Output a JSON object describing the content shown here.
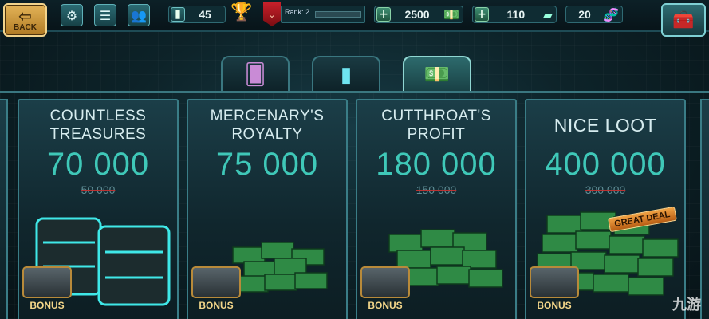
{
  "topbar": {
    "back_label": "BACK",
    "level_value": "45",
    "rank_label": "Rank: 2",
    "rank_progress": 0.0,
    "currency_value": "2500",
    "gems_value": "110",
    "dna_value": "20"
  },
  "tabs": [
    {
      "name": "cards"
    },
    {
      "name": "energy"
    },
    {
      "name": "money"
    }
  ],
  "active_tab": 2,
  "cards": [
    {
      "title_line1": "COUNTLESS",
      "title_line2": "TREASURES",
      "amount": "70 000",
      "old_amount": "50 000",
      "bonus_label": "BONUS"
    },
    {
      "title_line1": "MERCENARY'S",
      "title_line2": "ROYALTY",
      "amount": "75 000",
      "old_amount": "",
      "bonus_label": "BONUS"
    },
    {
      "title_line1": "CUTTHROAT'S",
      "title_line2": "PROFIT",
      "amount": "180 000",
      "old_amount": "150 000",
      "bonus_label": "BONUS"
    },
    {
      "title_line1": "NICE LOOT",
      "title_line2": "",
      "amount": "400 000",
      "old_amount": "300 000",
      "bonus_label": "BONUS",
      "badge": "GREAT DEAL"
    }
  ],
  "watermark": "九游",
  "colors": {
    "accent": "#3fc8b8",
    "panel": "#1b3e48",
    "border": "#3a7d87",
    "gold": "#e0b440"
  }
}
